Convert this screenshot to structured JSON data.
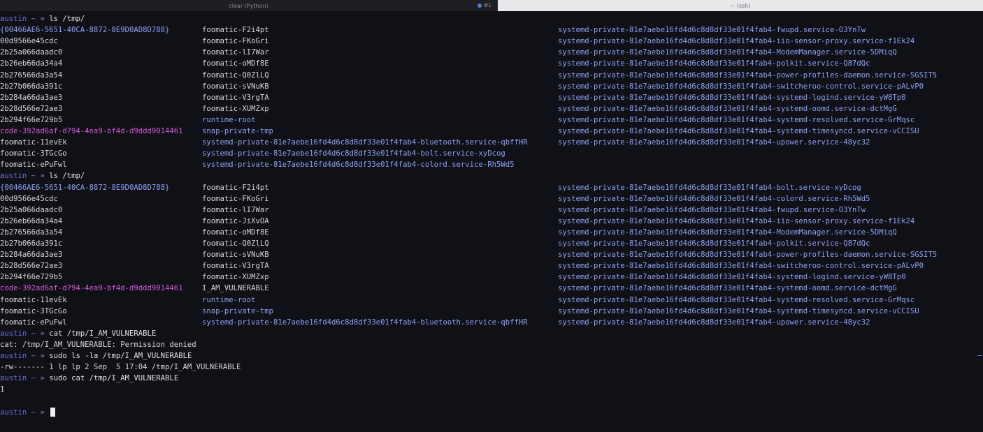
{
  "tabs": [
    {
      "title": "clear (Python)",
      "shortcut": "⌘1",
      "active": false
    },
    {
      "title": "~ (ssh)",
      "active": true
    }
  ],
  "prompt": {
    "user": "austin",
    "tilde": "~",
    "arrow": "»"
  },
  "colors": {
    "background": "#0f1117",
    "prompt_user": "#6c6fd6",
    "prompt_arrow": "#d06ad0",
    "directory": "#8fa0f2",
    "code_dir": "#d35ad3"
  },
  "lines": [
    {
      "type": "prompt",
      "cmd": "ls /tmp/"
    },
    {
      "type": "ls",
      "cols": [
        {
          "text": "{00466AE6-5651-40CA-8872-8E9D0AD8D788}",
          "style": "braces"
        },
        {
          "text": "foomatic-F2i4pt",
          "style": "plain"
        },
        {
          "text": "systemd-private-81e7aebe16fd4d6c8d8df33e01f4fab4-fwupd.service-O3YnTw",
          "style": "dir"
        }
      ]
    },
    {
      "type": "ls",
      "cols": [
        {
          "text": "00d9566e45cdc",
          "style": "plain"
        },
        {
          "text": "foomatic-FKoGri",
          "style": "plain"
        },
        {
          "text": "systemd-private-81e7aebe16fd4d6c8d8df33e01f4fab4-iio-sensor-proxy.service-f1Ek24",
          "style": "dir"
        }
      ]
    },
    {
      "type": "ls",
      "cols": [
        {
          "text": "2b25a066daadc0",
          "style": "plain"
        },
        {
          "text": "foomatic-lI7War",
          "style": "plain"
        },
        {
          "text": "systemd-private-81e7aebe16fd4d6c8d8df33e01f4fab4-ModemManager.service-5DMiqQ",
          "style": "dir"
        }
      ]
    },
    {
      "type": "ls",
      "cols": [
        {
          "text": "2b26eb66da34a4",
          "style": "plain"
        },
        {
          "text": "foomatic-oMDf8E",
          "style": "plain"
        },
        {
          "text": "systemd-private-81e7aebe16fd4d6c8d8df33e01f4fab4-polkit.service-Q87dQc",
          "style": "dir"
        }
      ]
    },
    {
      "type": "ls",
      "cols": [
        {
          "text": "2b276566da3a54",
          "style": "plain"
        },
        {
          "text": "foomatic-Q0ZlLQ",
          "style": "plain"
        },
        {
          "text": "systemd-private-81e7aebe16fd4d6c8d8df33e01f4fab4-power-profiles-daemon.service-SGSIT5",
          "style": "dir"
        }
      ]
    },
    {
      "type": "ls",
      "cols": [
        {
          "text": "2b27b066da391c",
          "style": "plain"
        },
        {
          "text": "foomatic-sVNuKB",
          "style": "plain"
        },
        {
          "text": "systemd-private-81e7aebe16fd4d6c8d8df33e01f4fab4-switcheroo-control.service-pALvP0",
          "style": "dir"
        }
      ]
    },
    {
      "type": "ls",
      "cols": [
        {
          "text": "2b284a66da3ae3",
          "style": "plain"
        },
        {
          "text": "foomatic-V3rgTA",
          "style": "plain"
        },
        {
          "text": "systemd-private-81e7aebe16fd4d6c8d8df33e01f4fab4-systemd-logind.service-yW8Tp0",
          "style": "dir"
        }
      ]
    },
    {
      "type": "ls",
      "cols": [
        {
          "text": "2b28d566e72ae3",
          "style": "plain"
        },
        {
          "text": "foomatic-XUMZxp",
          "style": "plain"
        },
        {
          "text": "systemd-private-81e7aebe16fd4d6c8d8df33e01f4fab4-systemd-oomd.service-dctMgG",
          "style": "dir"
        }
      ]
    },
    {
      "type": "ls",
      "cols": [
        {
          "text": "2b294f66e729b5",
          "style": "plain"
        },
        {
          "text": "runtime-root",
          "style": "dir"
        },
        {
          "text": "systemd-private-81e7aebe16fd4d6c8d8df33e01f4fab4-systemd-resolved.service-GrMqsc",
          "style": "dir"
        }
      ]
    },
    {
      "type": "ls",
      "cols": [
        {
          "text": "code-392ad6af-d794-4ea9-bf4d-d9ddd9014461",
          "style": "code-dir"
        },
        {
          "text": "snap-private-tmp",
          "style": "dir"
        },
        {
          "text": "systemd-private-81e7aebe16fd4d6c8d8df33e01f4fab4-systemd-timesyncd.service-vCCISU",
          "style": "dir"
        }
      ]
    },
    {
      "type": "ls",
      "cols": [
        {
          "text": "foomatic-11evEk",
          "style": "plain"
        },
        {
          "text": "systemd-private-81e7aebe16fd4d6c8d8df33e01f4fab4-bluetooth.service-qbffHR",
          "style": "dir"
        },
        {
          "text": "systemd-private-81e7aebe16fd4d6c8d8df33e01f4fab4-upower.service-48yc32",
          "style": "dir"
        }
      ]
    },
    {
      "type": "ls",
      "cols": [
        {
          "text": "foomatic-3TGcGo",
          "style": "plain"
        },
        {
          "text": "systemd-private-81e7aebe16fd4d6c8d8df33e01f4fab4-bolt.service-xyDcog",
          "style": "dir"
        },
        {
          "text": "",
          "style": "dir"
        }
      ]
    },
    {
      "type": "ls",
      "cols": [
        {
          "text": "foomatic-ePuFwl",
          "style": "plain"
        },
        {
          "text": "systemd-private-81e7aebe16fd4d6c8d8df33e01f4fab4-colord.service-Rh5Wd5",
          "style": "dir"
        },
        {
          "text": "",
          "style": "dir"
        }
      ]
    },
    {
      "type": "prompt",
      "cmd": "ls /tmp/"
    },
    {
      "type": "ls",
      "cols": [
        {
          "text": "{00466AE6-5651-40CA-8872-8E9D0AD8D788}",
          "style": "braces"
        },
        {
          "text": "foomatic-F2i4pt",
          "style": "plain"
        },
        {
          "text": "systemd-private-81e7aebe16fd4d6c8d8df33e01f4fab4-bolt.service-xyDcog",
          "style": "dir"
        }
      ]
    },
    {
      "type": "ls",
      "cols": [
        {
          "text": "00d9566e45cdc",
          "style": "plain"
        },
        {
          "text": "foomatic-FKoGri",
          "style": "plain"
        },
        {
          "text": "systemd-private-81e7aebe16fd4d6c8d8df33e01f4fab4-colord.service-Rh5Wd5",
          "style": "dir"
        }
      ]
    },
    {
      "type": "ls",
      "cols": [
        {
          "text": "2b25a066daadc0",
          "style": "plain"
        },
        {
          "text": "foomatic-lI7War",
          "style": "plain"
        },
        {
          "text": "systemd-private-81e7aebe16fd4d6c8d8df33e01f4fab4-fwupd.service-O3YnTw",
          "style": "dir"
        }
      ]
    },
    {
      "type": "ls",
      "cols": [
        {
          "text": "2b26eb66da34a4",
          "style": "plain"
        },
        {
          "text": "foomatic-JiXvOA",
          "style": "plain"
        },
        {
          "text": "systemd-private-81e7aebe16fd4d6c8d8df33e01f4fab4-iio-sensor-proxy.service-f1Ek24",
          "style": "dir"
        }
      ]
    },
    {
      "type": "ls",
      "cols": [
        {
          "text": "2b276566da3a54",
          "style": "plain"
        },
        {
          "text": "foomatic-oMDf8E",
          "style": "plain"
        },
        {
          "text": "systemd-private-81e7aebe16fd4d6c8d8df33e01f4fab4-ModemManager.service-5DMiqQ",
          "style": "dir"
        }
      ]
    },
    {
      "type": "ls",
      "cols": [
        {
          "text": "2b27b066da391c",
          "style": "plain"
        },
        {
          "text": "foomatic-Q0ZlLQ",
          "style": "plain"
        },
        {
          "text": "systemd-private-81e7aebe16fd4d6c8d8df33e01f4fab4-polkit.service-Q87dQc",
          "style": "dir"
        }
      ]
    },
    {
      "type": "ls",
      "cols": [
        {
          "text": "2b284a66da3ae3",
          "style": "plain"
        },
        {
          "text": "foomatic-sVNuKB",
          "style": "plain"
        },
        {
          "text": "systemd-private-81e7aebe16fd4d6c8d8df33e01f4fab4-power-profiles-daemon.service-SGSIT5",
          "style": "dir"
        }
      ]
    },
    {
      "type": "ls",
      "cols": [
        {
          "text": "2b28d566e72ae3",
          "style": "plain"
        },
        {
          "text": "foomatic-V3rgTA",
          "style": "plain"
        },
        {
          "text": "systemd-private-81e7aebe16fd4d6c8d8df33e01f4fab4-switcheroo-control.service-pALvP0",
          "style": "dir"
        }
      ]
    },
    {
      "type": "ls",
      "cols": [
        {
          "text": "2b294f66e729b5",
          "style": "plain"
        },
        {
          "text": "foomatic-XUMZxp",
          "style": "plain"
        },
        {
          "text": "systemd-private-81e7aebe16fd4d6c8d8df33e01f4fab4-systemd-logind.service-yW8Tp0",
          "style": "dir"
        }
      ]
    },
    {
      "type": "ls",
      "cols": [
        {
          "text": "code-392ad6af-d794-4ea9-bf4d-d9ddd9014461",
          "style": "code-dir"
        },
        {
          "text": "I_AM_VULNERABLE",
          "style": "plain"
        },
        {
          "text": "systemd-private-81e7aebe16fd4d6c8d8df33e01f4fab4-systemd-oomd.service-dctMgG",
          "style": "dir"
        }
      ]
    },
    {
      "type": "ls",
      "cols": [
        {
          "text": "foomatic-11evEk",
          "style": "plain"
        },
        {
          "text": "runtime-root",
          "style": "dir"
        },
        {
          "text": "systemd-private-81e7aebe16fd4d6c8d8df33e01f4fab4-systemd-resolved.service-GrMqsc",
          "style": "dir"
        }
      ]
    },
    {
      "type": "ls",
      "cols": [
        {
          "text": "foomatic-3TGcGo",
          "style": "plain"
        },
        {
          "text": "snap-private-tmp",
          "style": "dir"
        },
        {
          "text": "systemd-private-81e7aebe16fd4d6c8d8df33e01f4fab4-systemd-timesyncd.service-vCCISU",
          "style": "dir"
        }
      ]
    },
    {
      "type": "ls",
      "cols": [
        {
          "text": "foomatic-ePuFwl",
          "style": "plain"
        },
        {
          "text": "systemd-private-81e7aebe16fd4d6c8d8df33e01f4fab4-bluetooth.service-qbffHR",
          "style": "dir"
        },
        {
          "text": "systemd-private-81e7aebe16fd4d6c8d8df33e01f4fab4-upower.service-48yc32",
          "style": "dir"
        }
      ]
    },
    {
      "type": "prompt",
      "cmd": "cat /tmp/I_AM_VULNERABLE"
    },
    {
      "type": "out",
      "text": "cat: /tmp/I_AM_VULNERABLE: Permission denied"
    },
    {
      "type": "prompt",
      "cmd": "sudo ls -la /tmp/I_AM_VULNERABLE"
    },
    {
      "type": "out",
      "text": "-rw------- 1 lp lp 2 Sep  5 17:04 /tmp/I_AM_VULNERABLE"
    },
    {
      "type": "prompt",
      "cmd": "sudo cat /tmp/I_AM_VULNERABLE"
    },
    {
      "type": "out",
      "text": "1"
    },
    {
      "type": "out",
      "text": ""
    },
    {
      "type": "prompt-active",
      "cmd": ""
    }
  ]
}
